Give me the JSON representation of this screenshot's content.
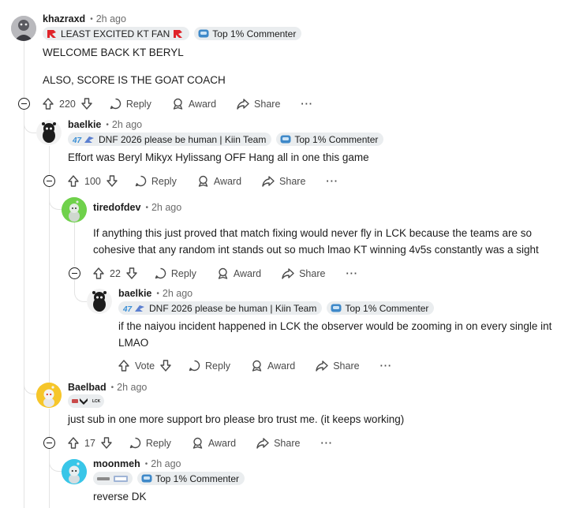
{
  "comments": [
    {
      "username": "khazraxd",
      "time": "2h ago",
      "flairs": [
        "LEAST EXCITED KT FAN",
        "Top 1% Commenter"
      ],
      "lines": [
        "WELCOME BACK KT BERYL",
        "ALSO, SCORE IS THE GOAT COACH"
      ],
      "score": "220"
    },
    {
      "username": "baelkie",
      "time": "2h ago",
      "flairs": [
        "DNF 2026 please be human | Kiin Team",
        "Top 1% Commenter"
      ],
      "lines": [
        "Effort was Beryl Mikyx Hylissang OFF Hang all in one this game"
      ],
      "score": "100"
    },
    {
      "username": "tiredofdev",
      "time": "2h ago",
      "flairs": [],
      "lines": [
        "If anything this just proved that match fixing would never fly in LCK because the teams are so",
        "cohesive that any random int stands out so much lmao KT winning 4v5s constantly was a sight"
      ],
      "score": "22"
    },
    {
      "username": "baelkie",
      "time": "2h ago",
      "flairs": [
        "DNF 2026 please be human | Kiin Team",
        "Top 1% Commenter"
      ],
      "lines": [
        "if the naiyou incident happened in LCK the observer would be zooming in on every single int",
        "LMAO"
      ],
      "score": "Vote"
    },
    {
      "username": "Baelbad",
      "time": "2h ago",
      "flairs": [
        "LCK"
      ],
      "lines": [
        "just sub in one more support bro please bro trust me. (it keeps working)"
      ],
      "score": "17"
    },
    {
      "username": "moonmeh",
      "time": "2h ago",
      "flairs": [
        "Top 1% Commenter"
      ],
      "lines": [
        "reverse DK"
      ],
      "score": ""
    }
  ],
  "actions": {
    "reply": "Reply",
    "award": "Award",
    "share": "Share",
    "more": "···"
  },
  "colors": {
    "flair_bg": "#eaedef",
    "thread_line": "#e3e3e3",
    "text": "#1c1c1c",
    "muted": "#6b6b6b"
  }
}
